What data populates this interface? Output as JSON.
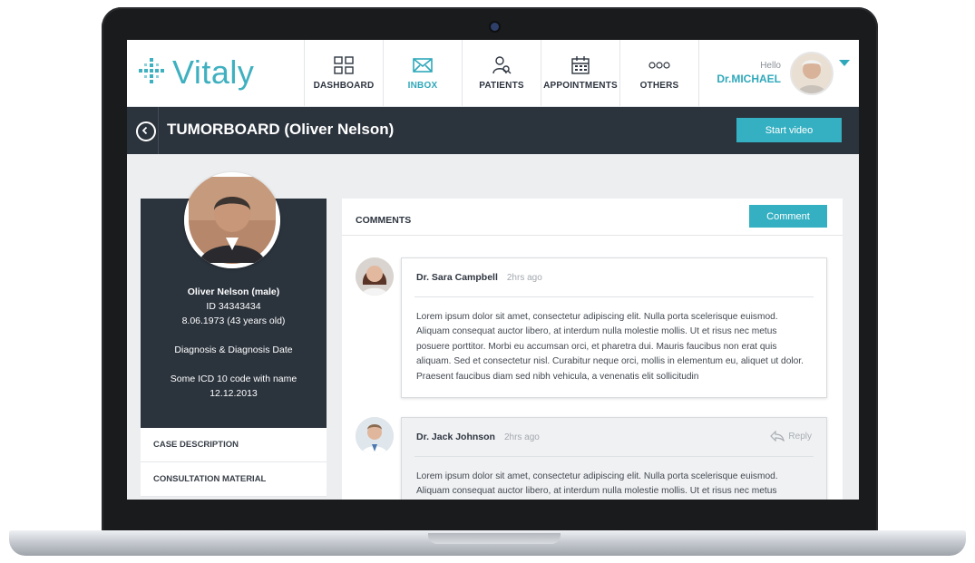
{
  "app": {
    "logo_text": "Vitaly",
    "brand_color": "#3fb0c0",
    "dark_color": "#2b333d"
  },
  "nav": {
    "items": [
      {
        "label": "DASHBOARD",
        "icon": "grid-icon"
      },
      {
        "label": "INBOX",
        "icon": "envelope-icon",
        "active": true
      },
      {
        "label": "PATIENTS",
        "icon": "patient-search-icon"
      },
      {
        "label": "APPOINTMENTS",
        "icon": "calendar-icon"
      },
      {
        "label": "OTHERS",
        "icon": "more-circles-icon"
      }
    ]
  },
  "user": {
    "greeting": "Hello",
    "name": "Dr.MICHAEL"
  },
  "titlebar": {
    "title": "TUMORBOARD (Oliver Nelson)",
    "start_video_label": "Start video"
  },
  "patient": {
    "name": "Oliver Nelson (male)",
    "id": "ID 34343434",
    "dob": "8.06.1973 (43 years old)",
    "diagnosis_label": "Diagnosis & Diagnosis Date",
    "icd_line": "Some ICD 10 code with name",
    "diagnosis_date": "12.12.2013"
  },
  "side_menu": {
    "items": [
      "CASE DESCRIPTION",
      "CONSULTATION MATERIAL"
    ]
  },
  "comments": {
    "title": "COMMENTS",
    "button_label": "Comment",
    "reply_label": "Reply",
    "items": [
      {
        "author": "Dr. Sara Campbell",
        "time": "2hrs ago",
        "body": "Lorem ipsum dolor sit amet, consectetur adipiscing elit. Nulla porta scelerisque euismod. Aliquam consequat auctor libero, at interdum nulla molestie mollis. Ut et risus nec metus posuere porttitor. Morbi eu accumsan orci, et pharetra dui. Mauris faucibus non erat quis aliquam. Sed et consectetur nisl. Curabitur neque orci, mollis in elementum eu, aliquet ut dolor. Praesent faucibus diam sed nibh vehicula, a venenatis elit sollicitudin"
      },
      {
        "author": "Dr. Jack Johnson",
        "time": "2hrs ago",
        "body": "Lorem ipsum dolor sit amet, consectetur adipiscing elit. Nulla porta scelerisque euismod. Aliquam consequat auctor libero, at interdum nulla molestie mollis. Ut et risus nec metus"
      }
    ]
  }
}
